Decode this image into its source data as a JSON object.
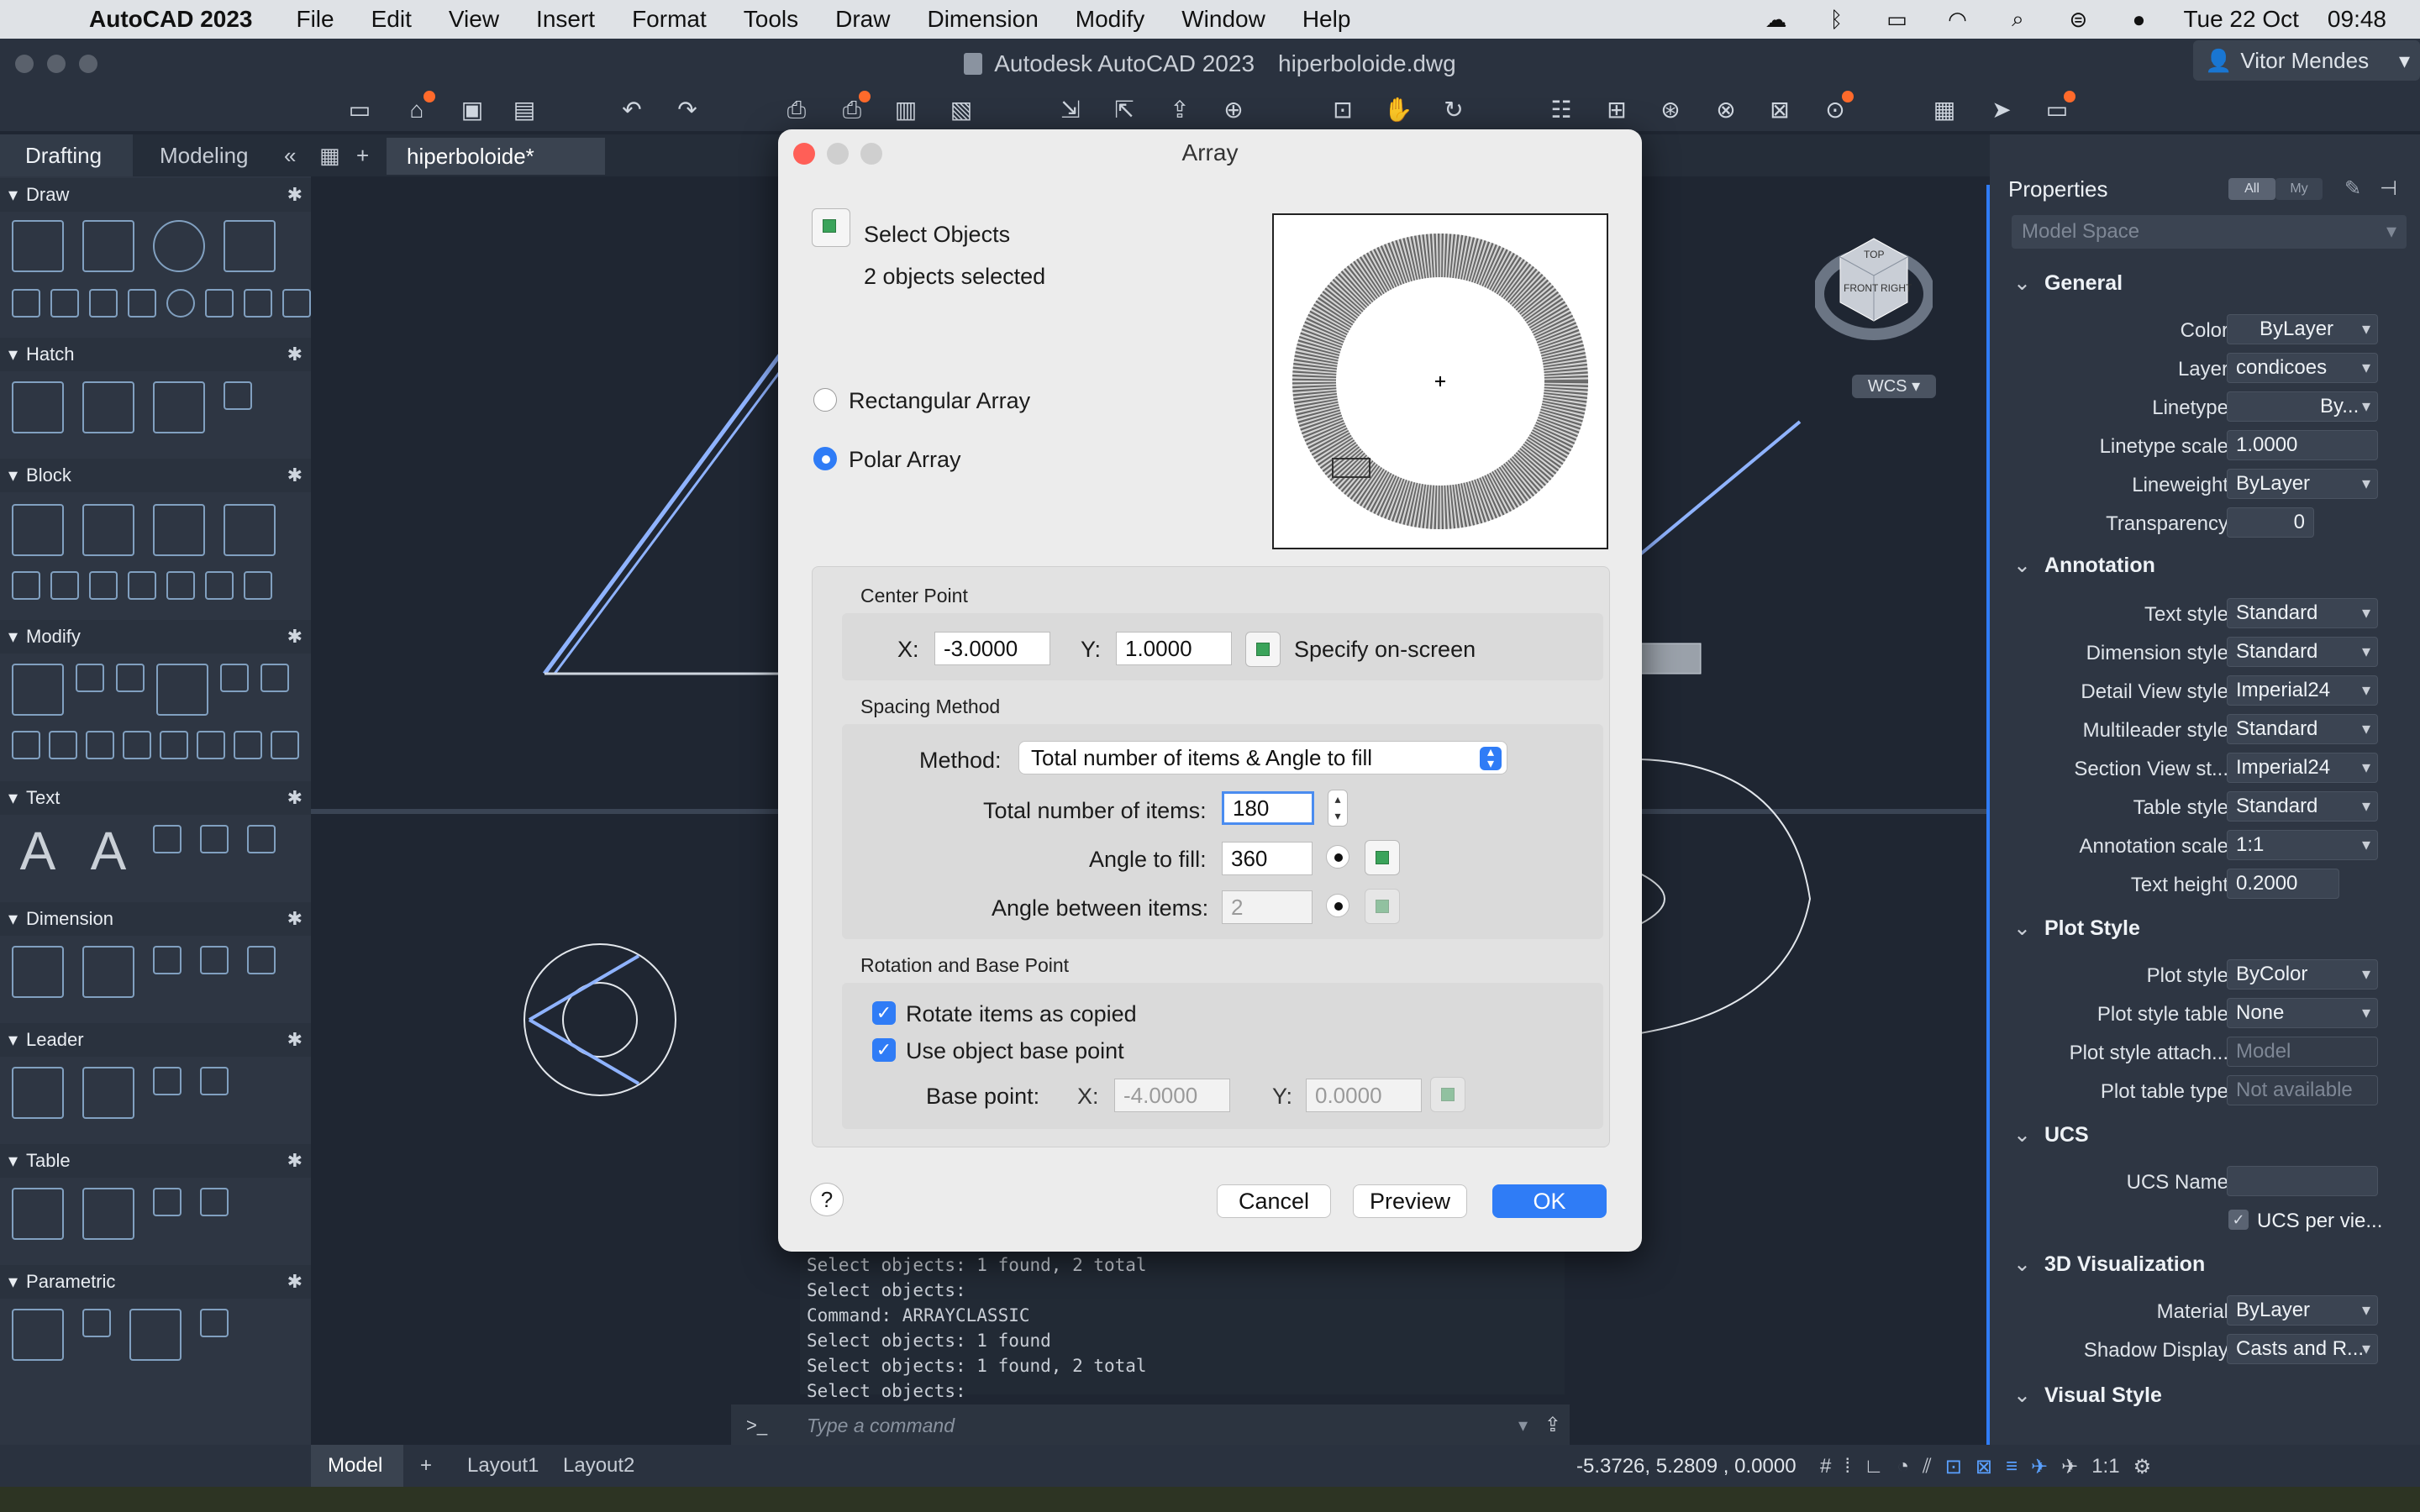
{
  "menubar": {
    "app": "AutoCAD 2023",
    "items": [
      "File",
      "Edit",
      "View",
      "Insert",
      "Format",
      "Tools",
      "Draw",
      "Dimension",
      "Modify",
      "Window",
      "Help"
    ],
    "date": "Tue 22 Oct",
    "time": "09:48"
  },
  "window": {
    "title": "Autodesk AutoCAD 2023",
    "file": "hiperboloide.dwg",
    "user": "Vitor Mendes"
  },
  "workspace_tabs": [
    "Drafting",
    "Modeling"
  ],
  "doc_tab": "hiperboloide*",
  "palette": {
    "sections": [
      "Draw",
      "Hatch",
      "Block",
      "Modify",
      "Text",
      "Dimension",
      "Leader",
      "Table",
      "Parametric"
    ]
  },
  "dialog": {
    "title": "Array",
    "select_objects": "Select Objects",
    "selected_count": "2 objects selected",
    "rect_array": "Rectangular Array",
    "polar_array": "Polar Array",
    "center_point": {
      "heading": "Center Point",
      "x_label": "X:",
      "x_value": "-3.0000",
      "y_label": "Y:",
      "y_value": "1.0000",
      "specify": "Specify on-screen"
    },
    "spacing": {
      "heading": "Spacing Method",
      "method_label": "Method:",
      "method_value": "Total number of items & Angle to fill",
      "total_label": "Total number of items:",
      "total_value": "180",
      "angle_fill_label": "Angle to fill:",
      "angle_fill_value": "360",
      "angle_between_label": "Angle between items:",
      "angle_between_value": "2"
    },
    "rotation": {
      "heading": "Rotation and Base Point",
      "rotate_items": "Rotate items as copied",
      "use_base": "Use object base point",
      "base_label": "Base point:",
      "x_label": "X:",
      "x_value": "-4.0000",
      "y_label": "Y:",
      "y_value": "0.0000"
    },
    "help": "?",
    "cancel": "Cancel",
    "preview": "Preview",
    "ok": "OK"
  },
  "command": {
    "history": [
      "Select objects: 1 found, 2 total",
      "Select objects:",
      "Command: ARRAYCLASSIC",
      "Select objects: 1 found",
      "Select objects: 1 found, 2 total",
      "Select objects:"
    ],
    "prompt": ">_",
    "placeholder": "Type a command"
  },
  "properties": {
    "title": "Properties",
    "filter_all": "All",
    "filter_my": "My",
    "context": "Model Space",
    "groups": [
      {
        "name": "General",
        "rows": [
          {
            "label": "Color",
            "value": "ByLayer"
          },
          {
            "label": "Layer",
            "value": "condicoes"
          },
          {
            "label": "Linetype",
            "value": "By..."
          },
          {
            "label": "Linetype scale",
            "value": "1.0000"
          },
          {
            "label": "Lineweight",
            "value": "ByLayer"
          },
          {
            "label": "Transparency",
            "value": "0"
          }
        ]
      },
      {
        "name": "Annotation",
        "rows": [
          {
            "label": "Text style",
            "value": "Standard"
          },
          {
            "label": "Dimension style",
            "value": "Standard"
          },
          {
            "label": "Detail View style",
            "value": "Imperial24"
          },
          {
            "label": "Multileader style",
            "value": "Standard"
          },
          {
            "label": "Section View st...",
            "value": "Imperial24"
          },
          {
            "label": "Table style",
            "value": "Standard"
          },
          {
            "label": "Annotation scale",
            "value": "1:1"
          },
          {
            "label": "Text height",
            "value": "0.2000"
          }
        ]
      },
      {
        "name": "Plot Style",
        "rows": [
          {
            "label": "Plot style",
            "value": "ByColor"
          },
          {
            "label": "Plot style table",
            "value": "None"
          },
          {
            "label": "Plot style attach...",
            "value": "Model"
          },
          {
            "label": "Plot table type",
            "value": "Not available"
          }
        ]
      },
      {
        "name": "UCS",
        "rows": [
          {
            "label": "UCS Name",
            "value": ""
          },
          {
            "label": "",
            "value": "UCS per vie..."
          }
        ]
      },
      {
        "name": "3D Visualization",
        "rows": [
          {
            "label": "Material",
            "value": "ByLayer"
          },
          {
            "label": "Shadow Display",
            "value": "Casts and R..."
          }
        ]
      },
      {
        "name": "Visual Style",
        "rows": []
      }
    ]
  },
  "viewcube": {
    "ucs": "WCS",
    "top": "TOP",
    "front": "FRONT",
    "right": "RIGHT"
  },
  "status": {
    "tabs": [
      "Model",
      "Layout1",
      "Layout2"
    ],
    "coords": "-5.3726, 5.2809 , 0.0000",
    "scale": "1:1"
  }
}
